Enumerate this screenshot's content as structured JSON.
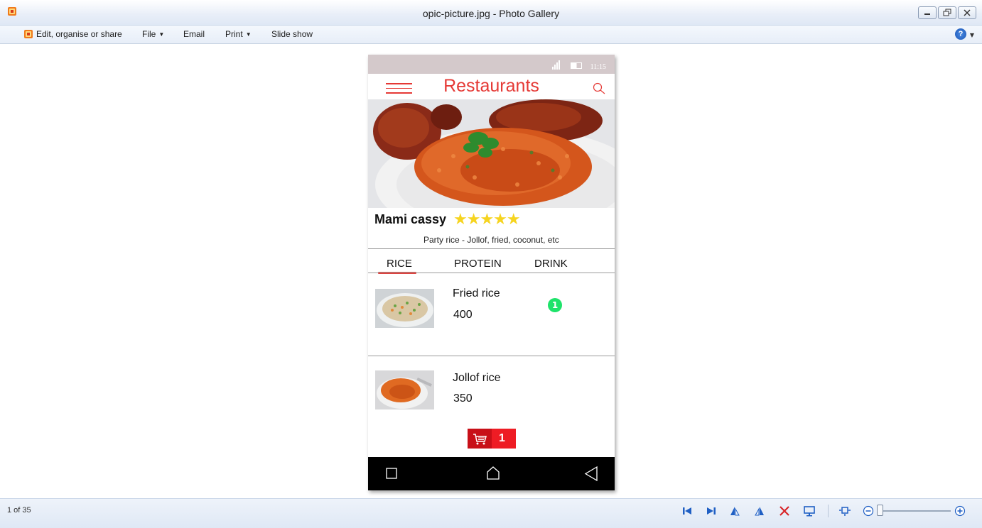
{
  "window": {
    "title": "opic-picture.jpg - Photo Gallery"
  },
  "menu": {
    "edit": "Edit, organise or share",
    "file": "File",
    "email": "Email",
    "print": "Print",
    "slideshow": "Slide show",
    "help": "?"
  },
  "phone": {
    "status_time": "11:15",
    "app_title": "Restaurants",
    "restaurant_name": "Mami cassy",
    "rating_stars": "★★★★★",
    "rating": 5,
    "description": "Party rice - Jollof, fried, coconut, etc",
    "tabs": [
      "RICE",
      "PROTEIN",
      "DRINK"
    ],
    "active_tab": "RICE",
    "items": [
      {
        "name": "Fried rice",
        "price": "400",
        "qty": "1"
      },
      {
        "name": "Jollof rice",
        "price": "350"
      }
    ],
    "cart_count": "1"
  },
  "footer": {
    "page_indicator": "1 of 35"
  },
  "colors": {
    "accent": "#e53935",
    "badge_green": "#1ee36a",
    "star_yellow": "#f6d420",
    "cart_red": "#ee1c24"
  }
}
